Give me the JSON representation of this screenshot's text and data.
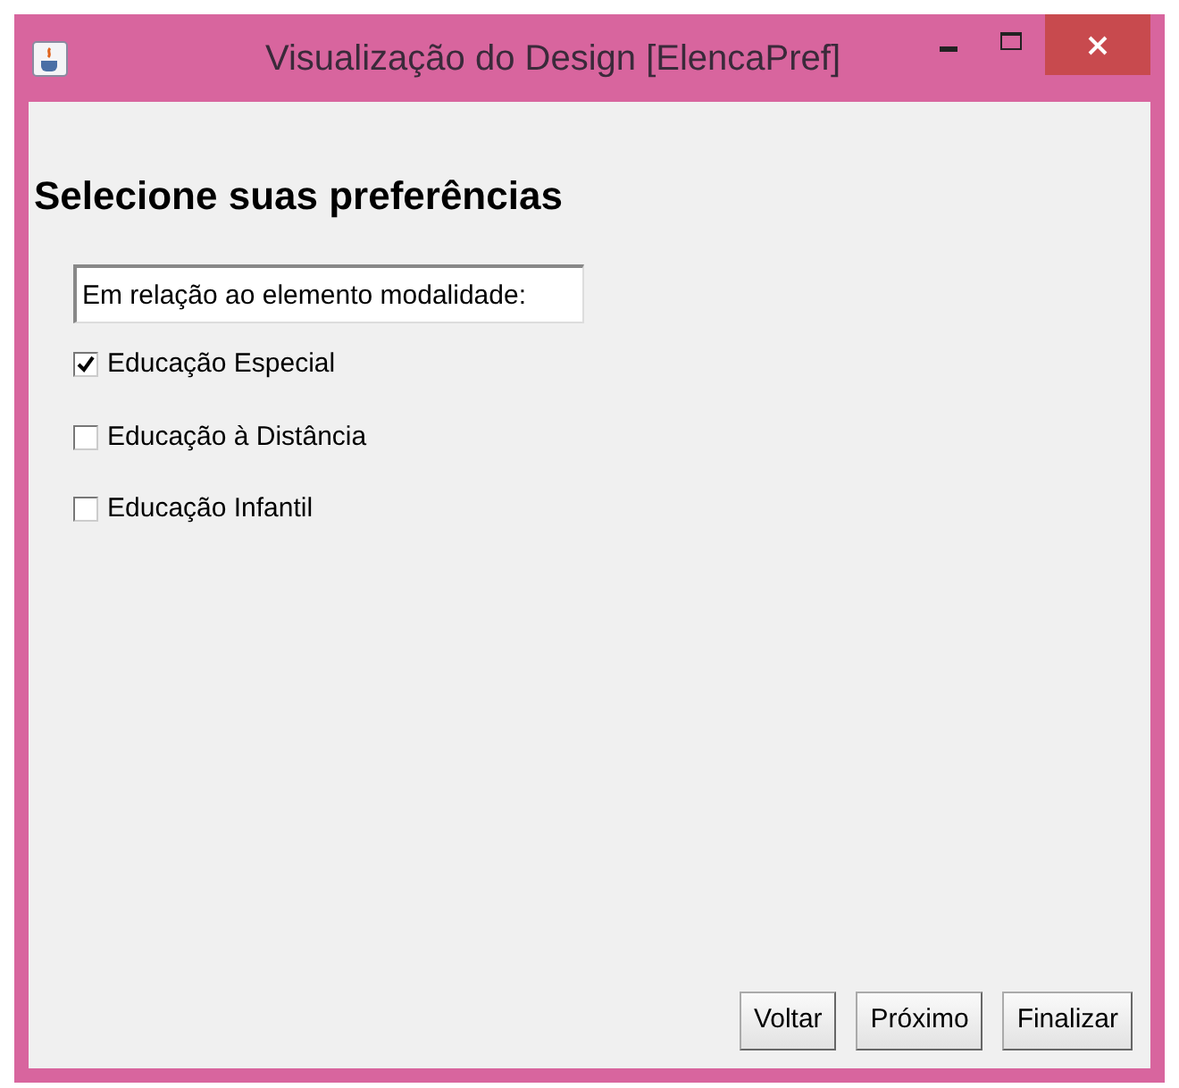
{
  "window": {
    "title": "Visualização do Design [ElencaPref]"
  },
  "heading": "Selecione suas preferências",
  "field": {
    "value": "Em relação ao elemento modalidade:"
  },
  "options": [
    {
      "label": "Educação Especial",
      "checked": true
    },
    {
      "label": "Educação à Distância",
      "checked": false
    },
    {
      "label": "Educação Infantil",
      "checked": false
    }
  ],
  "buttons": [
    "Voltar",
    "Próximo",
    "Finalizar"
  ]
}
